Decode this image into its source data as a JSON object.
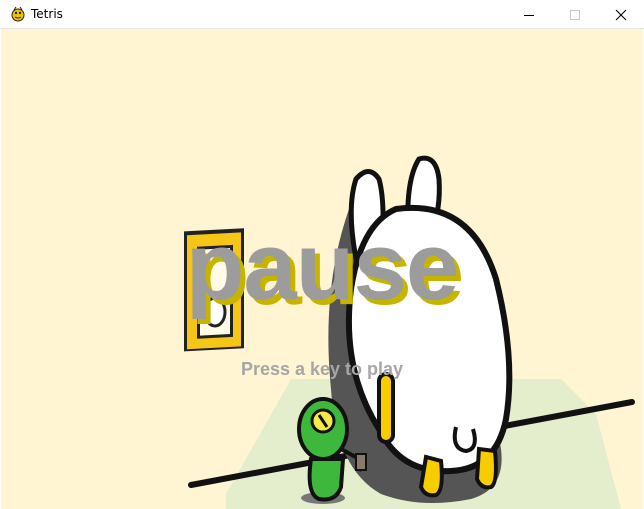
{
  "window": {
    "title": "Tetris",
    "app_icon": "pygame-snake-icon",
    "controls": [
      "minimize-icon",
      "maximize-icon",
      "close-icon"
    ]
  },
  "game": {
    "overlay_title": "pause",
    "overlay_hint": "Press a key to play"
  },
  "colors": {
    "background": "#fff5d3",
    "overlay_text": "#9c9c9c",
    "overlay_shadow": "#c6b400",
    "hint_text": "#a6a6a6"
  }
}
